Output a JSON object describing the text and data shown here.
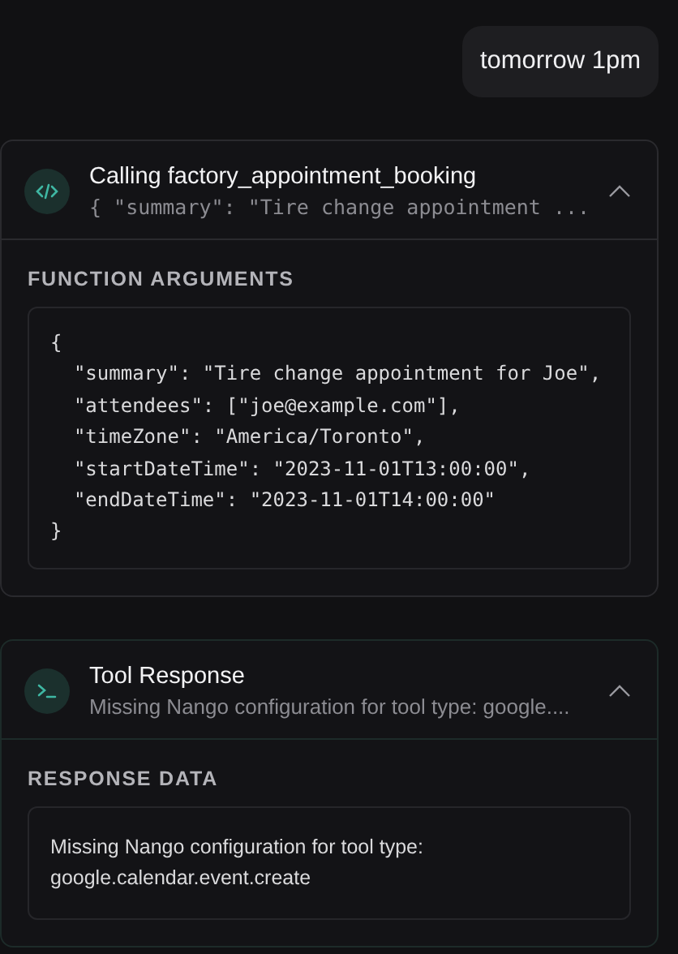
{
  "user_message": {
    "text": "tomorrow 1pm"
  },
  "cards": [
    {
      "kind": "function_call",
      "title": "Calling factory_appointment_booking",
      "subtitle": "{ \"summary\": \"Tire change appointment ...",
      "expanded": true,
      "section_label": "FUNCTION ARGUMENTS",
      "body_lines": [
        "{",
        "  \"summary\": \"Tire change appointment for Joe\",",
        "  \"attendees\": [\"joe@example.com\"],",
        "  \"timeZone\": \"America/Toronto\",",
        "  \"startDateTime\": \"2023-11-01T13:00:00\",",
        "  \"endDateTime\": \"2023-11-01T14:00:00\"",
        "}"
      ]
    },
    {
      "kind": "tool_response",
      "title": "Tool Response",
      "subtitle": "Missing Nango configuration for tool type: google....",
      "expanded": true,
      "section_label": "RESPONSE DATA",
      "body_lines": [
        "Missing Nango configuration for tool type: google.calendar.event.create"
      ]
    }
  ]
}
